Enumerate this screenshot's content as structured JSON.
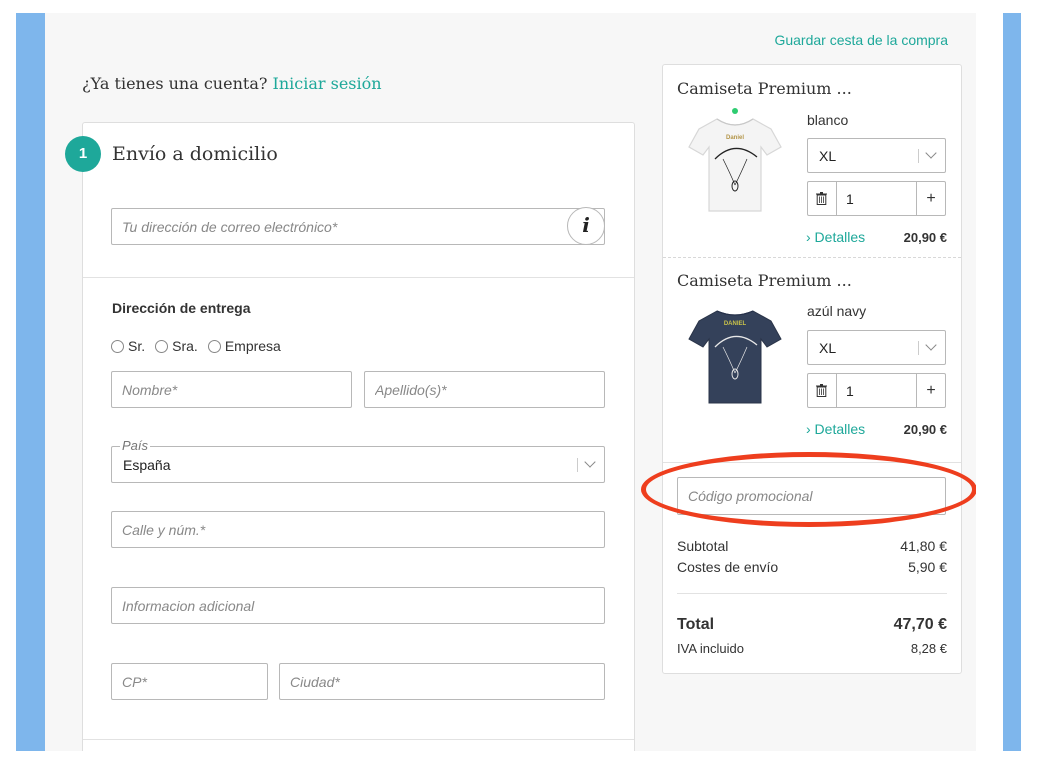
{
  "header": {
    "save_cart_link": "Guardar cesta de la compra",
    "account_prompt": "¿Ya tienes una cuenta?",
    "login_link": "Iniciar sesión"
  },
  "shipping": {
    "step_number": "1",
    "title": "Envío a domicilio",
    "email_placeholder": "Tu dirección de correo electrónico*",
    "info_icon_glyph": "i",
    "address_section_title": "Dirección de entrega",
    "salutations": [
      "Sr.",
      "Sra.",
      "Empresa"
    ],
    "first_name_placeholder": "Nombre*",
    "last_name_placeholder": "Apellido(s)*",
    "country_label": "País",
    "country_value": "España",
    "street_placeholder": "Calle y núm.*",
    "additional_info_placeholder": "Informacion adicional",
    "postal_code_placeholder": "CP*",
    "city_placeholder": "Ciudad*"
  },
  "cart": {
    "items": [
      {
        "title": "Camiseta Premium ...",
        "color": "blanco",
        "size": "XL",
        "quantity": "1",
        "details_link": "› Detalles",
        "price": "20,90 €",
        "shirt_print": "Daniel",
        "shirt_color": "#f4f4f4"
      },
      {
        "title": "Camiseta Premium ...",
        "color": "azúl navy",
        "size": "XL",
        "quantity": "1",
        "details_link": "› Detalles",
        "price": "20,90 €",
        "shirt_print": "DANIEL",
        "shirt_color": "#34415a"
      }
    ],
    "plus_glyph": "+",
    "promo_placeholder": "Código promocional",
    "subtotal_label": "Subtotal",
    "subtotal_value": "41,80 €",
    "shipping_label": "Costes de envío",
    "shipping_value": "5,90 €",
    "total_label": "Total",
    "total_value": "47,70 €",
    "vat_label": "IVA incluido",
    "vat_value": "8,28 €"
  },
  "colors": {
    "accent": "#1ea89a",
    "highlight": "#ee3e1e",
    "side_bars": "#7eb6ec"
  }
}
